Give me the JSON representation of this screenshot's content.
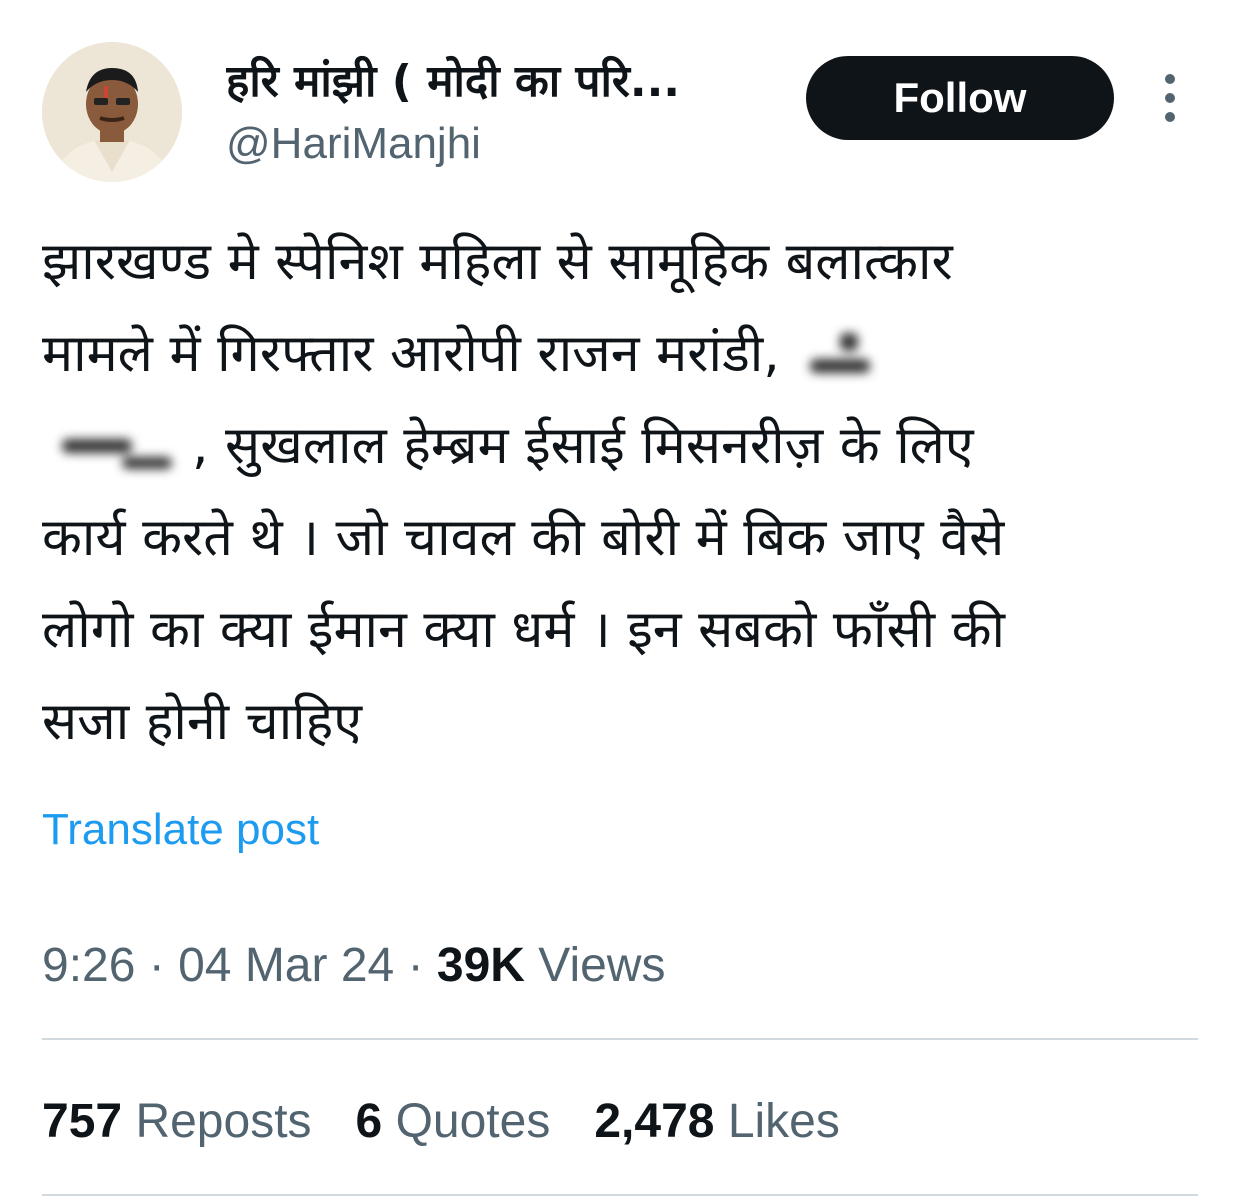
{
  "author": {
    "display_name": "हरि मांझी ( मोदी का परि...",
    "handle": "@HariManjhi",
    "avatar_icon": "profile-photo"
  },
  "actions": {
    "follow_label": "Follow",
    "more_icon": "vertical-ellipsis-icon"
  },
  "tweet": {
    "lines": [
      "झारखण्ड मे स्पेनिश महिला से सामूहिक बलात्कार",
      "मामले में गिरफ्तार आरोपी राजन मरांडी,",
      ", सुखलाल हेम्ब्रम ईसाई मिसनरीज़ के लिए",
      "कार्य करते थे । जो चावल की बोरी में बिक जाए वैसे",
      "लोगो का क्या ईमान क्या धर्म । इन सबको फाँसी की",
      "सजा होनी चाहिए"
    ],
    "translate_label": "Translate post"
  },
  "meta": {
    "time": "9:26",
    "separator": "·",
    "date": "04 Mar 24",
    "views_count": "39K",
    "views_label": "Views"
  },
  "stats": {
    "reposts_count": "757",
    "reposts_label": "Reposts",
    "quotes_count": "6",
    "quotes_label": "Quotes",
    "likes_count": "2,478",
    "likes_label": "Likes"
  },
  "colors": {
    "link": "#1d9bf0",
    "secondary_text": "#536471",
    "primary_text": "#0f1419",
    "divider": "#cfd9de",
    "button_bg": "#0f1419"
  }
}
